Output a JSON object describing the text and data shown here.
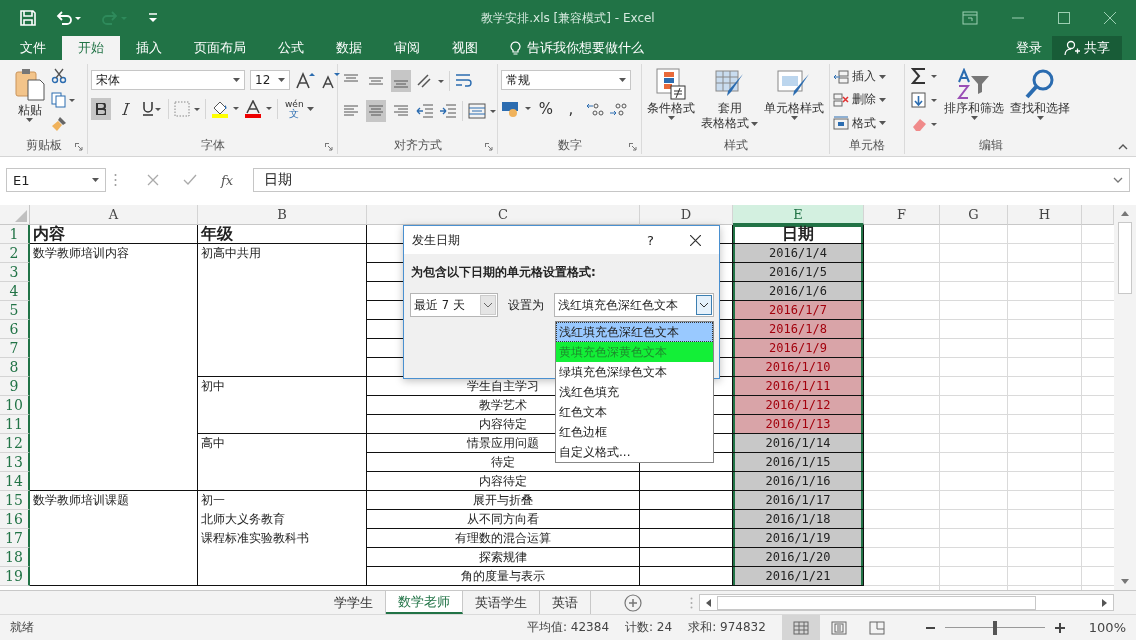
{
  "title_bar": {
    "title": "教学安排.xls  [兼容模式] - Excel"
  },
  "menu": {
    "tabs": [
      {
        "label": "文件",
        "selected": false
      },
      {
        "label": "开始",
        "selected": true
      },
      {
        "label": "插入",
        "selected": false
      },
      {
        "label": "页面布局",
        "selected": false
      },
      {
        "label": "公式",
        "selected": false
      },
      {
        "label": "数据",
        "selected": false
      },
      {
        "label": "审阅",
        "selected": false
      },
      {
        "label": "视图",
        "selected": false
      }
    ],
    "tell_me": "告诉我你想要做什么",
    "sign_in": "登录",
    "share": "共享"
  },
  "ribbon": {
    "clipboard": {
      "paste": "粘贴",
      "label": "剪贴板"
    },
    "font": {
      "name": "宋体",
      "size": "12",
      "bold": true,
      "italic": false,
      "underline": false,
      "phonetic_top": "wén",
      "phonetic_bottom": "文",
      "label": "字体"
    },
    "alignment": {
      "vertical": [
        {
          "kind": "top",
          "selected": false
        },
        {
          "kind": "middle",
          "selected": false
        },
        {
          "kind": "bottom",
          "selected": true
        }
      ],
      "horizontal": [
        {
          "kind": "left",
          "selected": false
        },
        {
          "kind": "center",
          "selected": true
        },
        {
          "kind": "right",
          "selected": false
        }
      ],
      "label": "对齐方式"
    },
    "number": {
      "format": "常规",
      "percent": "%",
      "comma": ",",
      "label": "数字"
    },
    "styles": {
      "conditional": "条件格式",
      "table_top": "套用",
      "table_bottom": "表格格式",
      "cell_styles": "单元格样式",
      "label": "样式"
    },
    "cells": {
      "insert": "插入",
      "delete": "删除",
      "format": "格式",
      "label": "单元格"
    },
    "editing": {
      "sort": "排序和筛选",
      "find": "查找和选择",
      "label": "编辑"
    }
  },
  "formula_bar": {
    "name_box": "E1",
    "fx": "fx",
    "content": "日期"
  },
  "sheet": {
    "columns": [
      {
        "label": "A",
        "selected": false
      },
      {
        "label": "B",
        "selected": false
      },
      {
        "label": "C",
        "selected": false
      },
      {
        "label": "D",
        "selected": false
      },
      {
        "label": "E",
        "selected": true
      },
      {
        "label": "F",
        "selected": false
      },
      {
        "label": "G",
        "selected": false
      },
      {
        "label": "H",
        "selected": false
      }
    ],
    "row_numbers": [
      "1",
      "2",
      "3",
      "4",
      "5",
      "6",
      "7",
      "8",
      "9",
      "10",
      "11",
      "12",
      "13",
      "14",
      "15",
      "16",
      "17",
      "18",
      "19"
    ],
    "headers": [
      "内容",
      "年级"
    ],
    "column_a": [
      "数学教师培训内容",
      "数学教师培训课题"
    ],
    "column_b": [
      {
        "lines": [
          "初高中共用"
        ]
      },
      {
        "lines": [
          "初中"
        ]
      },
      {
        "lines": [
          "高中"
        ]
      },
      {
        "lines": [
          "初一",
          "北师大义务教育",
          "课程标准实验教科书"
        ]
      }
    ],
    "column_c": [
      "学生自主学习",
      "教学艺术",
      "内容待定",
      "情景应用问题",
      "待定",
      "内容待定",
      "展开与折叠",
      "从不同方向看",
      "有理数的混合运算",
      "探索规律",
      "角的度量与表示"
    ],
    "date_header": "日期",
    "dates": [
      {
        "text": "2016/1/4",
        "highlighted": false
      },
      {
        "text": "2016/1/5",
        "highlighted": false
      },
      {
        "text": "2016/1/6",
        "highlighted": false
      },
      {
        "text": "2016/1/7",
        "highlighted": true
      },
      {
        "text": "2016/1/8",
        "highlighted": true
      },
      {
        "text": "2016/1/9",
        "highlighted": true
      },
      {
        "text": "2016/1/10",
        "highlighted": true
      },
      {
        "text": "2016/1/11",
        "highlighted": true
      },
      {
        "text": "2016/1/12",
        "highlighted": true
      },
      {
        "text": "2016/1/13",
        "highlighted": true
      },
      {
        "text": "2016/1/14",
        "highlighted": false
      },
      {
        "text": "2016/1/15",
        "highlighted": false
      },
      {
        "text": "2016/1/16",
        "highlighted": false
      },
      {
        "text": "2016/1/17",
        "highlighted": false
      },
      {
        "text": "2016/1/18",
        "highlighted": false
      },
      {
        "text": "2016/1/19",
        "highlighted": false
      },
      {
        "text": "2016/1/20",
        "highlighted": false
      },
      {
        "text": "2016/1/21",
        "highlighted": false
      }
    ]
  },
  "dialog": {
    "title": "发生日期",
    "help": "?",
    "prompt": "为包含以下日期的单元格设置格式:",
    "period": "最近 7 天",
    "set_as": "设置为",
    "format": "浅红填充色深红色文本",
    "options": [
      {
        "label": "浅红填充色深红色文本",
        "selected": true,
        "hovered": false
      },
      {
        "label": "黄填充色深黄色文本",
        "selected": false,
        "hovered": true
      },
      {
        "label": "绿填充色深绿色文本",
        "selected": false,
        "hovered": false
      },
      {
        "label": "浅红色填充",
        "selected": false,
        "hovered": false
      },
      {
        "label": "红色文本",
        "selected": false,
        "hovered": false
      },
      {
        "label": "红色边框",
        "selected": false,
        "hovered": false
      },
      {
        "label": "自定义格式...",
        "selected": false,
        "hovered": false
      }
    ]
  },
  "sheet_tabs": [
    {
      "label": "学学生",
      "selected": false
    },
    {
      "label": "数学老师",
      "selected": true
    },
    {
      "label": "英语学生",
      "selected": false
    },
    {
      "label": "英语",
      "selected": false
    }
  ],
  "status_bar": {
    "ready": "就绪",
    "average": "平均值: 42384",
    "count": "计数: 24",
    "sum": "求和: 974832",
    "views": [
      {
        "kind": "normal",
        "selected": true
      },
      {
        "kind": "page_layout",
        "selected": false
      },
      {
        "kind": "page_break",
        "selected": false
      }
    ],
    "zoom": {
      "level": 0.5,
      "text": "100%"
    }
  }
}
